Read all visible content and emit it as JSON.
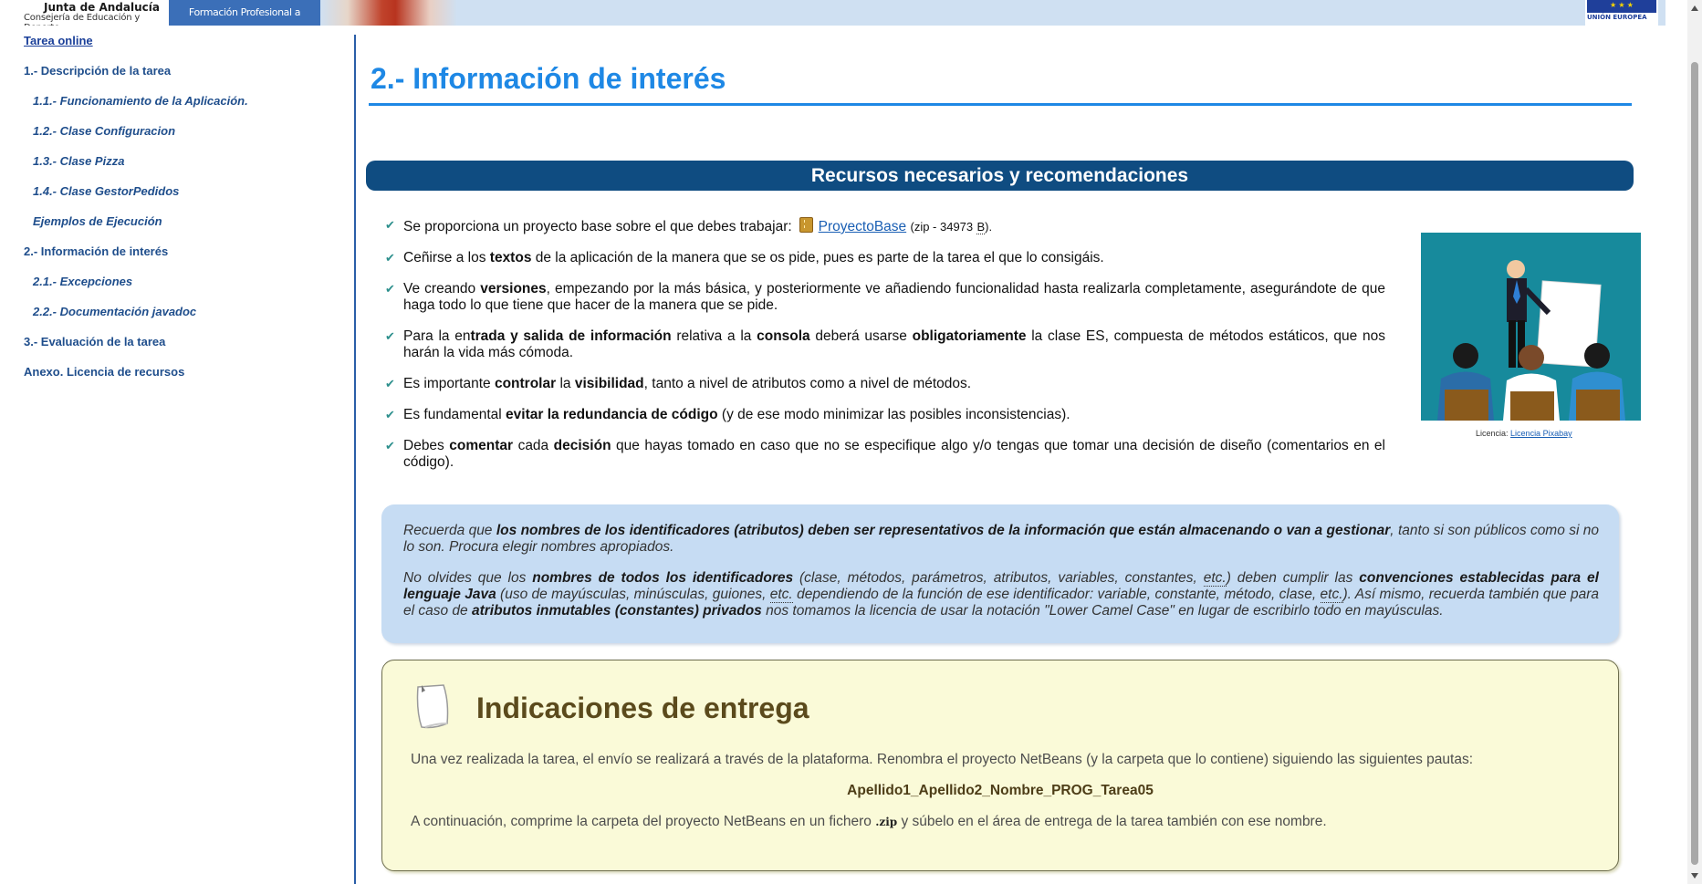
{
  "header": {
    "org_title": "Junta de Andalucía",
    "org_subtitle": "Consejería de Educación y Deporte",
    "program_banner": "Formación Profesional a Distancia",
    "eu_label": "UNIÓN EUROPEA"
  },
  "sidebar": {
    "items": [
      {
        "label": "Tarea online"
      },
      {
        "label": "1.- Descripción de la tarea"
      },
      {
        "label": "1.1.- Funcionamiento de la Aplicación."
      },
      {
        "label": "1.2.- Clase Configuracion"
      },
      {
        "label": "1.3.- Clase Pizza"
      },
      {
        "label": "1.4.- Clase GestorPedidos"
      },
      {
        "label": "Ejemplos de Ejecución"
      },
      {
        "label": "2.- Información de interés"
      },
      {
        "label": "2.1.- Excepciones"
      },
      {
        "label": "2.2.- Documentación javadoc"
      },
      {
        "label": "3.- Evaluación de la tarea"
      },
      {
        "label": "Anexo. Licencia de recursos"
      }
    ]
  },
  "main": {
    "title": "2.- Información de interés",
    "section_heading": "Recursos necesarios y recomendaciones",
    "bullets": {
      "b1_pre": "Se proporciona un proyecto base sobre el que debes trabajar:",
      "b1_link": "ProyectoBase",
      "b1_size_pre": "(zip - 34973",
      "b1_size_unit": "B",
      "b1_size_post": ").",
      "b2_pre": "Ceñirse a los",
      "b2_bold": "textos",
      "b2_post": "de la aplicación de la manera que se os pide, pues es parte de la tarea el que lo consigáis.",
      "b3_pre": "Ve creando",
      "b3_bold": "versiones",
      "b3_post": ", empezando por la más básica, y posteriormente ve añadiendo funcionalidad hasta realizarla completamente, asegurándote de que haga todo lo que tiene que hacer de la manera que se pide.",
      "b4_a": "Para la en",
      "b4_b": "trada y salida de información",
      "b4_c": "relativa a la",
      "b4_d": "consola",
      "b4_e": "deberá usarse",
      "b4_f": "obligatoriamente",
      "b4_g": "la clase ES, compuesta de métodos estáticos, que nos harán la vida más cómoda.",
      "b5_a": "Es importante",
      "b5_b": "controlar",
      "b5_c": "la",
      "b5_d": "visibilidad",
      "b5_e": ", tanto a nivel de atributos como a nivel de métodos.",
      "b6_a": "Es fundamental",
      "b6_b": "evitar la redundancia de código",
      "b6_c": "(y de ese modo minimizar las posibles inconsistencias).",
      "b7_a": "Debes",
      "b7_b": "comentar",
      "b7_c": "cada",
      "b7_d": "decisión",
      "b7_e": "que hayas tomado en caso que no se especifique algo y/o tengas que tomar una decisión de diseño (comentarios en el código)."
    },
    "image_caption_label": "Licencia:",
    "image_caption_link": "Licencia Pixabay",
    "note": {
      "p1_a": "Recuerda que",
      "p1_b": "los nombres de los identificadores (atributos) deben ser representativos de la información que están almacenando o van a gestionar",
      "p1_c": ", tanto si son públicos como si no lo son. Procura elegir nombres apropiados.",
      "p2_a": "No olvides que los",
      "p2_b": "nombres de todos los identificadores",
      "p2_c": "(clase, métodos, parámetros, atributos, variables, constantes,",
      "p2_etc": "etc.",
      "p2_d": ") deben cumplir las",
      "p2_e": "convenciones establecidas para el lenguaje Java",
      "p2_f": "(uso de mayúsculas, minúsculas, guiones,",
      "p2_g": "dependiendo de la función de ese identificador: variable, constante, método, clase,",
      "p2_h": "). Así mismo, recuerda también que para el caso de",
      "p2_i": "atributos inmutables (constantes) privados",
      "p2_j": "nos tomamos la licencia de usar la notación \"Lower Camel Case\" en lugar de escribirlo todo en mayúsculas."
    },
    "delivery": {
      "title": "Indicaciones de entrega",
      "p1": "Una vez realizada la tarea, el envío se realizará a través de la plataforma. Renombra el proyecto NetBeans (y la carpeta que lo contiene) siguiendo las siguientes pautas:",
      "filename_pattern": "Apellido1_Apellido2_Nombre_PROG_Tarea05",
      "p2_a": "A continuación, comprime la carpeta del proyecto NetBeans en un fichero",
      "p2_ext": ".zip",
      "p2_b": "y súbelo en el área de entrega de la tarea también con ese nombre."
    }
  },
  "colors": {
    "title_blue": "#1e88e5",
    "banner_navy": "#0f4c81",
    "note_bg": "#c6dcf3",
    "delivery_bg": "#fafad8",
    "check_teal": "#2c8f8c"
  }
}
